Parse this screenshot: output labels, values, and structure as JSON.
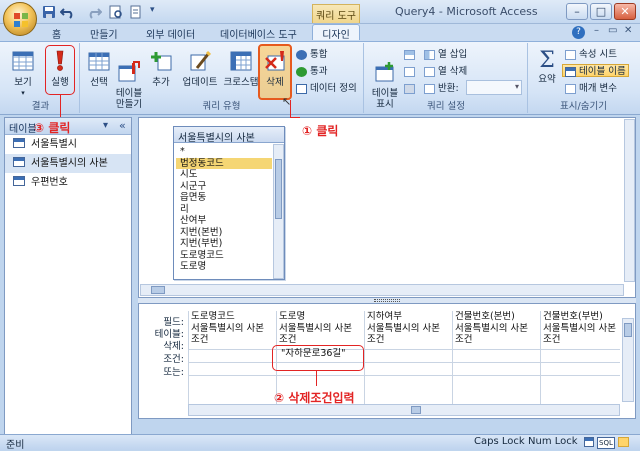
{
  "window": {
    "title": "Query4 - Microsoft Access",
    "context_tab": "쿼리 도구",
    "controls": [
      "–",
      "□",
      "✕"
    ]
  },
  "tabs": [
    "홈",
    "만들기",
    "외부 데이터",
    "데이터베이스 도구",
    "디자인"
  ],
  "active_tab": "디자인",
  "ribbon": {
    "results": {
      "label": "결과",
      "view": "보기",
      "run": "실행"
    },
    "query_type": {
      "label": "쿼리 유형",
      "select": "선택",
      "make_table": "테이블\n만들기",
      "append": "추가",
      "update": "업데이트",
      "crosstab": "크로스탭",
      "delete": "삭제",
      "union": "통합",
      "pass_through": "통과",
      "data_definition": "데이터 정의"
    },
    "query_setup": {
      "label": "쿼리 설정",
      "show_table": "테이블\n표시",
      "insert_rows": "",
      "delete_rows": "",
      "builder": "",
      "insert_columns": "열 삽입",
      "delete_columns": "열 삭제",
      "return": "반환:",
      "return_value": ""
    },
    "show_hide": {
      "label": "표시/숨기기",
      "totals": "요약",
      "property_sheet": "속성 시트",
      "table_names": "테이블 이름",
      "parameters": "매개 변수"
    }
  },
  "nav_pane": {
    "header": "테이블",
    "items": [
      {
        "label": "서울특별시",
        "selected": false
      },
      {
        "label": "서울특별시의 사본",
        "selected": true
      },
      {
        "label": "우편번호",
        "selected": false
      }
    ]
  },
  "table_box": {
    "title": "서울특별시의 사본",
    "fields": [
      "*",
      "법정동코드",
      "시도",
      "시군구",
      "읍면동",
      "리",
      "산여부",
      "지번(본번)",
      "지번(부번)",
      "도로명코드",
      "도로명"
    ],
    "selected_field": "법정동코드"
  },
  "grid": {
    "row_labels": [
      "필드:",
      "테이블:",
      "삭제:",
      "조건:",
      "또는:"
    ],
    "columns": [
      {
        "field": "도로명코드",
        "table": "서울특별시의 사본",
        "delete": "조건",
        "criteria": ""
      },
      {
        "field": "도로명",
        "table": "서울특별시의 사본",
        "delete": "조건",
        "criteria": "\"자하문로36길\""
      },
      {
        "field": "지하여부",
        "table": "서울특별시의 사본",
        "delete": "조건",
        "criteria": ""
      },
      {
        "field": "건물번호(본번)",
        "table": "서울특별시의 사본",
        "delete": "조건",
        "criteria": ""
      },
      {
        "field": "건물번호(부번)",
        "table": "서울특별시의 사본",
        "delete": "조건",
        "criteria": ""
      }
    ]
  },
  "annotations": {
    "click_delete": "① 클릭",
    "enter_criteria": "② 삭제조건입력",
    "click_run": "③ 클릭"
  },
  "status_bar": {
    "left": "준비",
    "caps_lock": "Caps Lock",
    "num_lock": "Num Lock",
    "view_label": "SQL"
  }
}
